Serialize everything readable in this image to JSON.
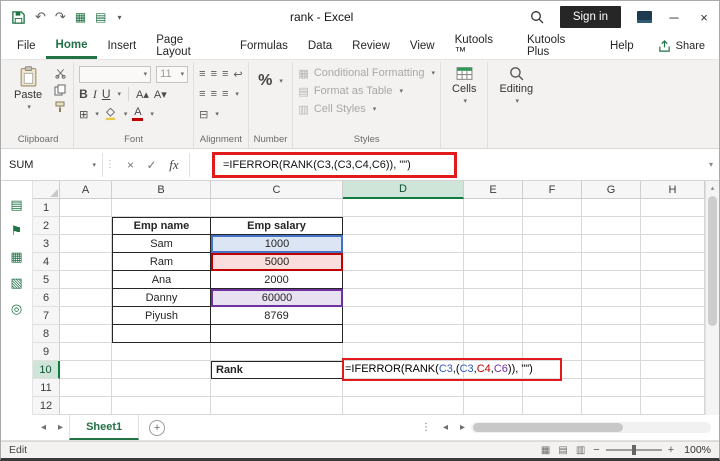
{
  "titlebar": {
    "title": "rank - Excel",
    "sign_in_label": "Sign in"
  },
  "tabs": {
    "file": "File",
    "home": "Home",
    "insert": "Insert",
    "page_layout": "Page Layout",
    "formulas": "Formulas",
    "data": "Data",
    "review": "Review",
    "view": "View",
    "kutools": "Kutools ™",
    "kutools_plus": "Kutools Plus",
    "help": "Help",
    "share": "Share"
  },
  "ribbon": {
    "paste_label": "Paste",
    "clipboard_group": "Clipboard",
    "font_size": "11",
    "font_group": "Font",
    "bold": "B",
    "italic": "I",
    "underline": "U",
    "grow_font": "A▴",
    "shrink_font": "A▾",
    "font_color_letter": "A",
    "alignment_group": "Alignment",
    "percent": "%",
    "number_group": "Number",
    "conditional_formatting": "Conditional Formatting",
    "format_as_table": "Format as Table",
    "cell_styles": "Cell Styles",
    "styles_group": "Styles",
    "cells_label": "Cells",
    "editing_label": "Editing"
  },
  "formula_bar": {
    "name_box": "SUM",
    "fx_label": "fx",
    "formula": "=IFERROR(RANK(C3,(C3,C4,C6)), \"\")"
  },
  "grid": {
    "columns": [
      "A",
      "B",
      "C",
      "D",
      "E",
      "F",
      "G",
      "H"
    ],
    "rows": [
      "1",
      "2",
      "3",
      "4",
      "5",
      "6",
      "7",
      "8",
      "9",
      "10",
      "11",
      "12"
    ],
    "active_column": "D",
    "active_row": "10",
    "table": {
      "header_name": "Emp name",
      "header_salary": "Emp salary",
      "rows": [
        {
          "name": "Sam",
          "salary": "1000"
        },
        {
          "name": "Ram",
          "salary": "5000"
        },
        {
          "name": "Ana",
          "salary": "2000"
        },
        {
          "name": "Danny",
          "salary": "60000"
        },
        {
          "name": "Piyush",
          "salary": "8769"
        }
      ]
    },
    "rank_label": "Rank",
    "active_cell_formula": [
      {
        "text": "=IFERROR(RANK(",
        "color": "#000000"
      },
      {
        "text": "C3",
        "color": "#2e5bbd"
      },
      {
        "text": ",(",
        "color": "#000000"
      },
      {
        "text": "C3",
        "color": "#2e5bbd"
      },
      {
        "text": ",",
        "color": "#000000"
      },
      {
        "text": "C4",
        "color": "#c00000"
      },
      {
        "text": ",",
        "color": "#000000"
      },
      {
        "text": "C6",
        "color": "#7030a0"
      },
      {
        "text": ")), \"\")",
        "color": "#000000"
      }
    ],
    "highlight_colors": {
      "c3_fill": "#dbe5f4",
      "c3_border": "#4472c4",
      "c4_fill": "#fadddd",
      "c4_border": "#c00000",
      "c6_fill": "#e8e1f2",
      "c6_border": "#7030a0",
      "red_box": "#e11b1b",
      "header_accent": "#107c41"
    }
  },
  "sheet_tabs": {
    "active_sheet": "Sheet1"
  },
  "status_bar": {
    "mode": "Edit",
    "zoom": "100%"
  },
  "icons": {
    "undo": "↶",
    "redo": "↷",
    "qat_1": "▦",
    "qat_2": "▤",
    "dropdown": "▾",
    "minimize": "─",
    "close": "×",
    "cancel": "×",
    "confirm": "✓",
    "borders": "⊞",
    "merge": "⊟",
    "wrap": "↩",
    "align": "≡",
    "nav_left": "◂",
    "nav_right": "▸",
    "splitter": "⋮",
    "scroll_up": "▴",
    "scroll_down": "▾",
    "view_normal": "▦",
    "view_layout": "▤",
    "view_break": "▥",
    "zoom_out": "−",
    "zoom_in": "+",
    "add_sheet": "+",
    "sidebar_1": "▤",
    "sidebar_2": "⚑",
    "sidebar_3": "▦",
    "sidebar_4": "▧",
    "sidebar_5": "◎"
  }
}
